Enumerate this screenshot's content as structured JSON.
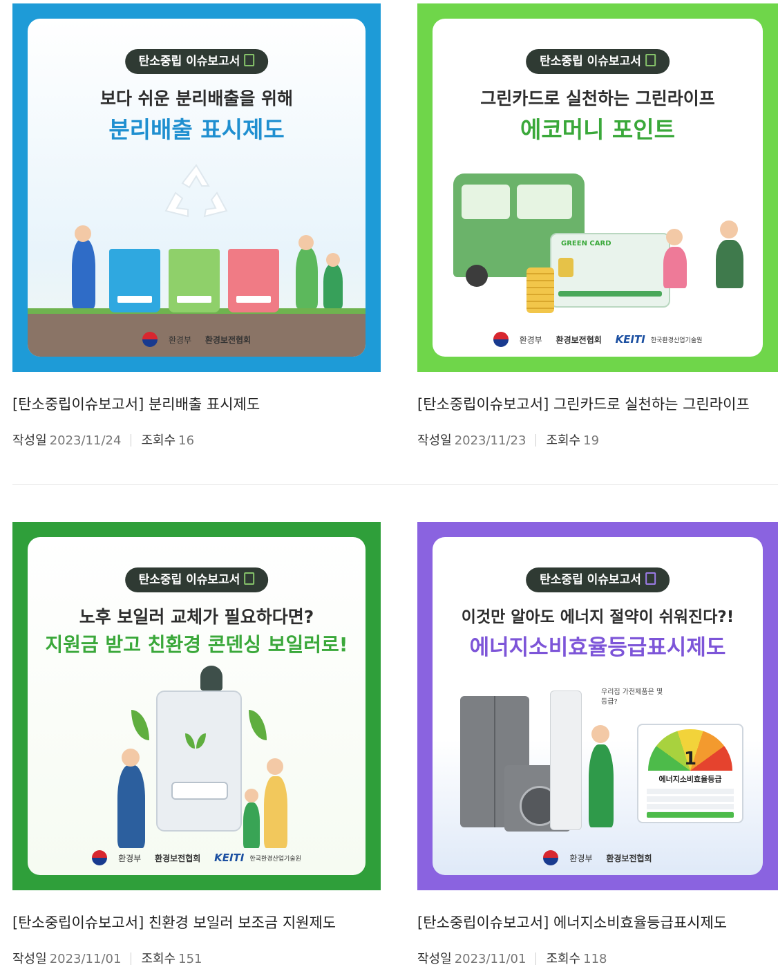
{
  "posts": [
    {
      "badge": "탄소중립 이슈보고서",
      "headline_top": "보다 쉬운 분리배출을 위해",
      "headline_main": "분리배출 표시제도",
      "title": "[탄소중립이슈보고서] 분리배출 표시제도",
      "date_label": "작성일",
      "date": "2023/11/24",
      "views_label": "조회수",
      "views": "16",
      "accent": "#1e9bd7",
      "logos": [
        "환경부",
        "환경보전협회"
      ]
    },
    {
      "badge": "탄소중립 이슈보고서",
      "headline_top": "그린카드로 실천하는 그린라이프",
      "headline_main": "에코머니 포인트",
      "card_text": "GREEN CARD",
      "title": "[탄소중립이슈보고서] 그린카드로 실천하는 그린라이프",
      "date_label": "작성일",
      "date": "2023/11/23",
      "views_label": "조회수",
      "views": "19",
      "accent": "#6fd64a",
      "logos": [
        "환경부",
        "환경보전협회",
        "KEITI",
        "한국환경산업기술원"
      ]
    },
    {
      "badge": "탄소중립 이슈보고서",
      "headline_top": "노후 보일러 교체가 필요하다면?",
      "headline_main": "지원금 받고 친환경 콘덴싱 보일러로!",
      "title": "[탄소중립이슈보고서] 친환경 보일러 보조금 지원제도",
      "date_label": "작성일",
      "date": "2023/11/01",
      "views_label": "조회수",
      "views": "151",
      "accent": "#2f9f3a",
      "logos": [
        "환경부",
        "환경보전협회",
        "KEITI",
        "한국환경산업기술원"
      ]
    },
    {
      "badge": "탄소중립 이슈보고서",
      "headline_top": "이것만 알아도 에너지 절약이 쉬워진다?!",
      "headline_main": "에너지소비효율등급표시제도",
      "label_title": "에너지소비효율등급",
      "grade": "1",
      "thought": "우리집 가전제품은 몇 등급?",
      "title": "[탄소중립이슈보고서] 에너지소비효율등급표시제도",
      "date_label": "작성일",
      "date": "2023/11/01",
      "views_label": "조회수",
      "views": "118",
      "accent": "#8a63e0",
      "logos": [
        "환경부",
        "환경보전협회"
      ]
    }
  ]
}
